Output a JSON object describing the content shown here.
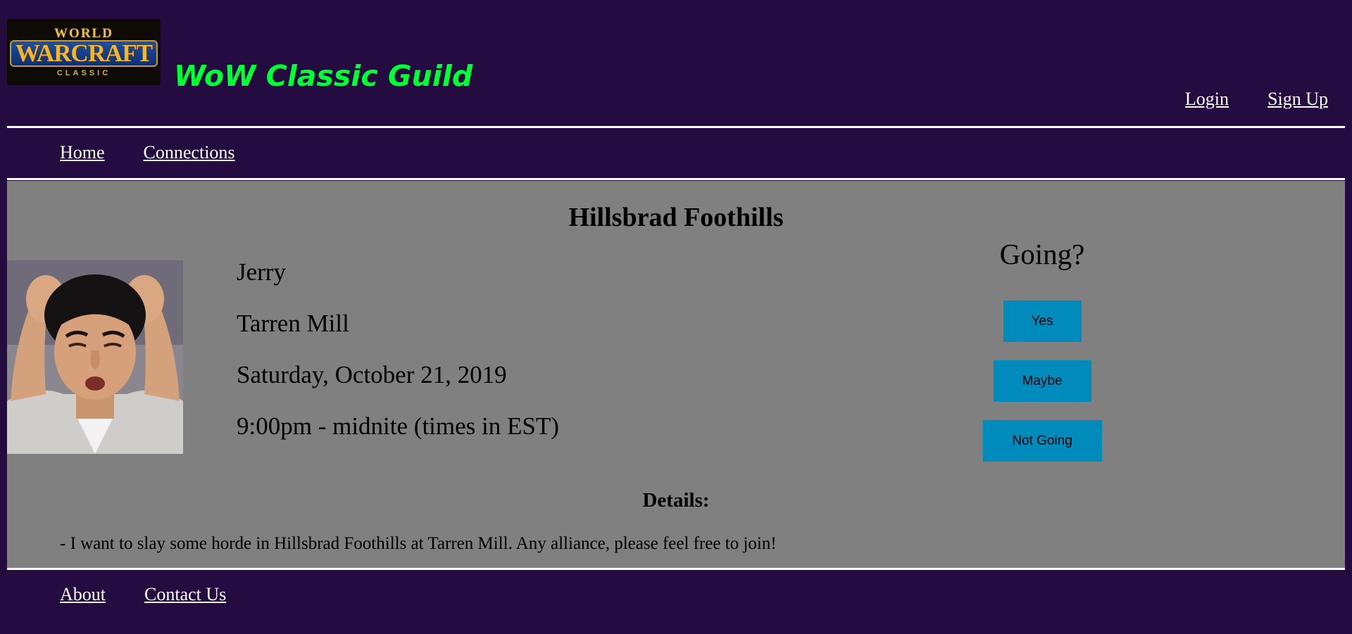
{
  "header": {
    "logo": {
      "top": "WORLD",
      "main": "WARCRAFT",
      "sub": "CLASSIC"
    },
    "site_title": "WoW Classic Guild",
    "auth": {
      "login": "Login",
      "signup": "Sign Up"
    }
  },
  "nav": {
    "items": [
      {
        "label": "Home"
      },
      {
        "label": "Connections"
      }
    ]
  },
  "event": {
    "title": "Hillsbrad Foothills",
    "organizer": "Jerry",
    "location": "Tarren Mill",
    "date": "Saturday, October 21, 2019",
    "time": "9:00pm - midnite (times in EST)",
    "rsvp": {
      "label": "Going?",
      "yes": "Yes",
      "maybe": "Maybe",
      "not_going": "Not Going"
    },
    "details_heading": "Details:",
    "details_text": "- I want to slay some horde in Hillsbrad Foothills at Tarren Mill. Any alliance, please feel free to join!"
  },
  "footer": {
    "items": [
      {
        "label": "About"
      },
      {
        "label": "Contact Us"
      }
    ]
  },
  "colors": {
    "background": "#240b40",
    "content_bg": "#808080",
    "title_green": "#00ff33",
    "button_blue": "#008bbd",
    "divider": "#ffffff"
  }
}
